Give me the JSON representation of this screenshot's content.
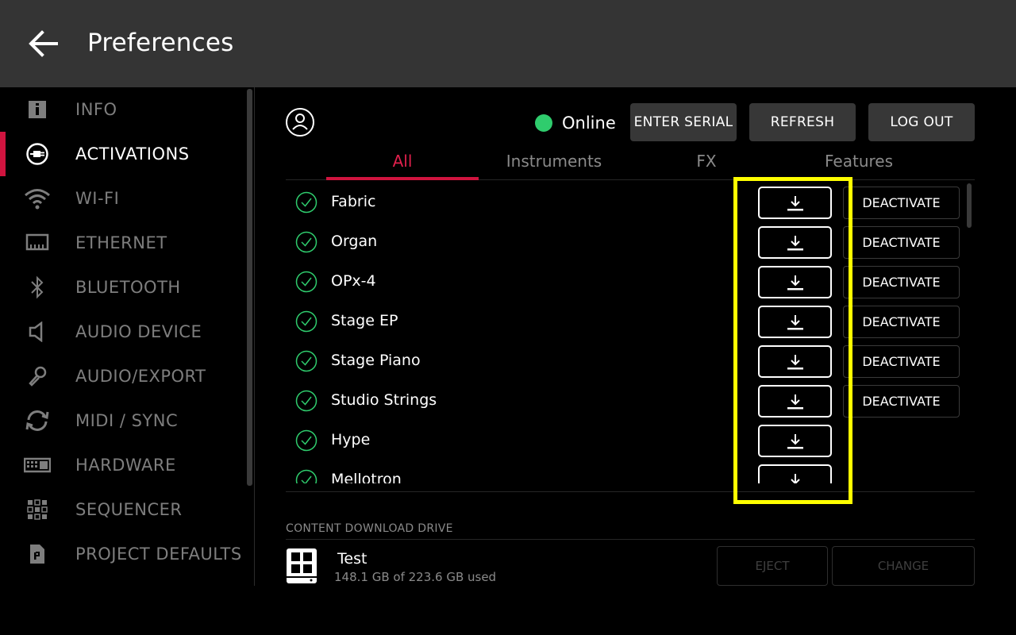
{
  "header": {
    "title": "Preferences"
  },
  "sidebar": {
    "items": [
      {
        "label": "INFO",
        "icon": "info-icon"
      },
      {
        "label": "ACTIVATIONS",
        "icon": "plug-icon",
        "active": true
      },
      {
        "label": "WI-FI",
        "icon": "wifi-icon"
      },
      {
        "label": "ETHERNET",
        "icon": "ethernet-icon"
      },
      {
        "label": "BLUETOOTH",
        "icon": "bluetooth-icon"
      },
      {
        "label": "AUDIO DEVICE",
        "icon": "speaker-icon"
      },
      {
        "label": "AUDIO/EXPORT",
        "icon": "microphone-icon"
      },
      {
        "label": "MIDI / SYNC",
        "icon": "sync-icon"
      },
      {
        "label": "HARDWARE",
        "icon": "keyboard-icon"
      },
      {
        "label": "SEQUENCER",
        "icon": "grid-icon"
      },
      {
        "label": "PROJECT DEFAULTS",
        "icon": "document-icon"
      }
    ]
  },
  "status": {
    "text": "Online",
    "color": "#2fcc6d"
  },
  "buttons": {
    "enter_serial": "ENTER SERIAL",
    "refresh": "REFRESH",
    "log_out": "LOG OUT"
  },
  "tabs": [
    {
      "label": "All",
      "active": true
    },
    {
      "label": "Instruments"
    },
    {
      "label": "FX"
    },
    {
      "label": "Features"
    }
  ],
  "items": [
    {
      "name": "Fabric",
      "deactivate": "DEACTIVATE"
    },
    {
      "name": "Organ",
      "deactivate": "DEACTIVATE"
    },
    {
      "name": "OPx-4",
      "deactivate": "DEACTIVATE"
    },
    {
      "name": "Stage EP",
      "deactivate": "DEACTIVATE"
    },
    {
      "name": "Stage Piano",
      "deactivate": "DEACTIVATE"
    },
    {
      "name": "Studio Strings",
      "deactivate": "DEACTIVATE"
    },
    {
      "name": "Hype",
      "deactivate": ""
    },
    {
      "name": "Mellotron",
      "deactivate": ""
    }
  ],
  "drive": {
    "section_label": "CONTENT DOWNLOAD DRIVE",
    "name": "Test",
    "usage": "148.1 GB of 223.6 GB used",
    "eject": "EJECT",
    "change": "CHANGE"
  },
  "colors": {
    "accent": "#d0143f",
    "highlight": "#ffff00",
    "online": "#2fcc6d"
  }
}
